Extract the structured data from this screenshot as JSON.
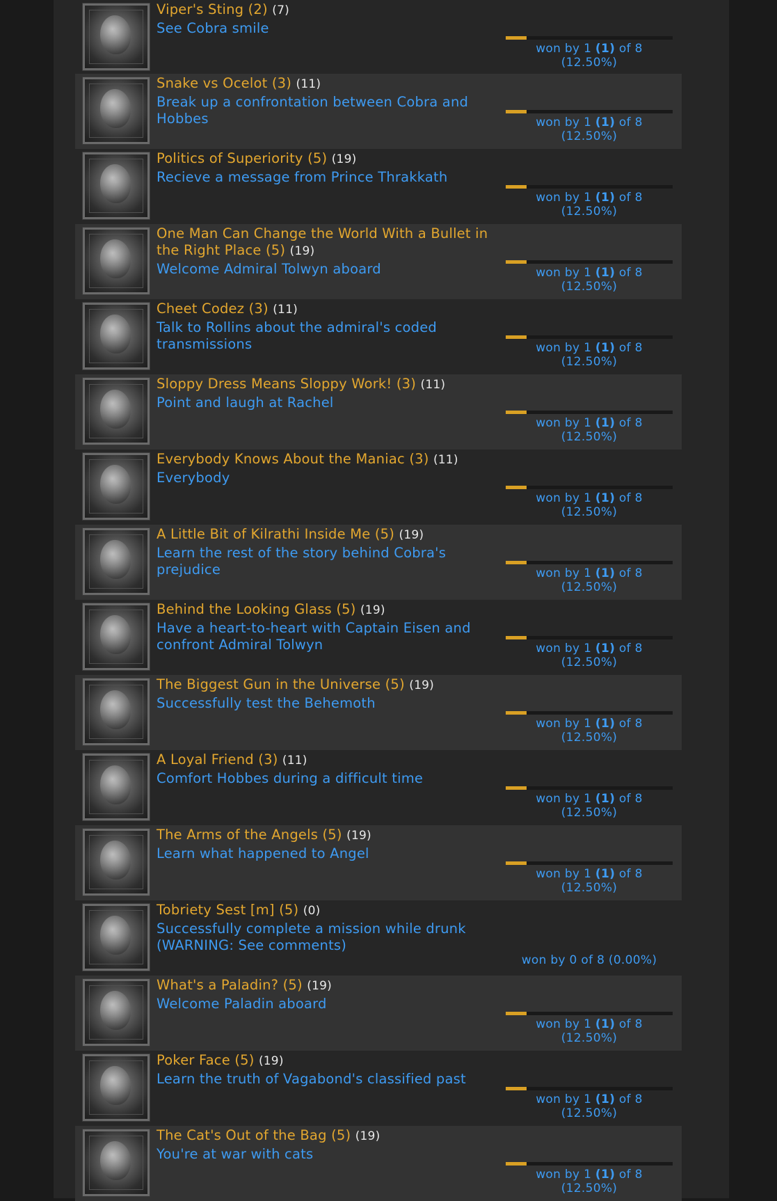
{
  "achievements": [
    {
      "title": "Viper's Sting",
      "points": "(2)",
      "count": "(7)",
      "description": "See Cobra smile",
      "won_by": "1",
      "won_by_bold": "(1)",
      "total": "8",
      "percent": "(12.50%)",
      "fill": 0.125
    },
    {
      "title": "Snake vs Ocelot",
      "points": "(3)",
      "count": "(11)",
      "description": "Break up a confrontation between Cobra and Hobbes",
      "won_by": "1",
      "won_by_bold": "(1)",
      "total": "8",
      "percent": "(12.50%)",
      "fill": 0.125
    },
    {
      "title": "Politics of Superiority",
      "points": "(5)",
      "count": "(19)",
      "description": "Recieve a message from Prince Thrakkath",
      "won_by": "1",
      "won_by_bold": "(1)",
      "total": "8",
      "percent": "(12.50%)",
      "fill": 0.125
    },
    {
      "title": "One Man Can Change the World With a Bullet in the Right Place",
      "points": "(5)",
      "count": "(19)",
      "description": "Welcome Admiral Tolwyn aboard",
      "won_by": "1",
      "won_by_bold": "(1)",
      "total": "8",
      "percent": "(12.50%)",
      "fill": 0.125
    },
    {
      "title": "Cheet Codez",
      "points": "(3)",
      "count": "(11)",
      "description": "Talk to Rollins about the admiral's coded transmissions",
      "won_by": "1",
      "won_by_bold": "(1)",
      "total": "8",
      "percent": "(12.50%)",
      "fill": 0.125
    },
    {
      "title": "Sloppy Dress Means Sloppy Work!",
      "points": "(3)",
      "count": "(11)",
      "description": "Point and laugh at Rachel",
      "won_by": "1",
      "won_by_bold": "(1)",
      "total": "8",
      "percent": "(12.50%)",
      "fill": 0.125
    },
    {
      "title": "Everybody Knows About the Maniac",
      "points": "(3)",
      "count": "(11)",
      "description": "Everybody",
      "won_by": "1",
      "won_by_bold": "(1)",
      "total": "8",
      "percent": "(12.50%)",
      "fill": 0.125
    },
    {
      "title": "A Little Bit of Kilrathi Inside Me",
      "points": "(5)",
      "count": "(19)",
      "description": "Learn the rest of the story behind Cobra's prejudice",
      "won_by": "1",
      "won_by_bold": "(1)",
      "total": "8",
      "percent": "(12.50%)",
      "fill": 0.125
    },
    {
      "title": "Behind the Looking Glass",
      "points": "(5)",
      "count": "(19)",
      "description": "Have a heart-to-heart with Captain Eisen and confront Admiral Tolwyn",
      "won_by": "1",
      "won_by_bold": "(1)",
      "total": "8",
      "percent": "(12.50%)",
      "fill": 0.125
    },
    {
      "title": "The Biggest Gun in the Universe",
      "points": "(5)",
      "count": "(19)",
      "description": "Successfully test the Behemoth",
      "won_by": "1",
      "won_by_bold": "(1)",
      "total": "8",
      "percent": "(12.50%)",
      "fill": 0.125
    },
    {
      "title": "A Loyal Friend",
      "points": "(3)",
      "count": "(11)",
      "description": "Comfort Hobbes during a difficult time",
      "won_by": "1",
      "won_by_bold": "(1)",
      "total": "8",
      "percent": "(12.50%)",
      "fill": 0.125
    },
    {
      "title": "The Arms of the Angels",
      "points": "(5)",
      "count": "(19)",
      "description": "Learn what happened to Angel",
      "won_by": "1",
      "won_by_bold": "(1)",
      "total": "8",
      "percent": "(12.50%)",
      "fill": 0.125
    },
    {
      "title": "Tobriety Sest [m]",
      "points": "(5)",
      "count": "(0)",
      "description": "Successfully complete a mission while drunk (WARNING: See comments)",
      "won_by_zero_text": "won by 0 of 8 (0.00%)",
      "fill": 0
    },
    {
      "title": "What's a Paladin?",
      "points": "(5)",
      "count": "(19)",
      "description": "Welcome Paladin aboard",
      "won_by": "1",
      "won_by_bold": "(1)",
      "total": "8",
      "percent": "(12.50%)",
      "fill": 0.125
    },
    {
      "title": "Poker Face",
      "points": "(5)",
      "count": "(19)",
      "description": "Learn the truth of Vagabond's classified past",
      "won_by": "1",
      "won_by_bold": "(1)",
      "total": "8",
      "percent": "(12.50%)",
      "fill": 0.125
    },
    {
      "title": "The Cat's Out of the Bag",
      "points": "(5)",
      "count": "(19)",
      "description": "You're at war with cats",
      "won_by": "1",
      "won_by_bold": "(1)",
      "total": "8",
      "percent": "(12.50%)",
      "fill": 0.125
    }
  ],
  "labels": {
    "won_by": "won by",
    "of": "of"
  },
  "colors": {
    "title": "#e3a72f",
    "link": "#3e9bf2",
    "bar": "#d9a024"
  }
}
